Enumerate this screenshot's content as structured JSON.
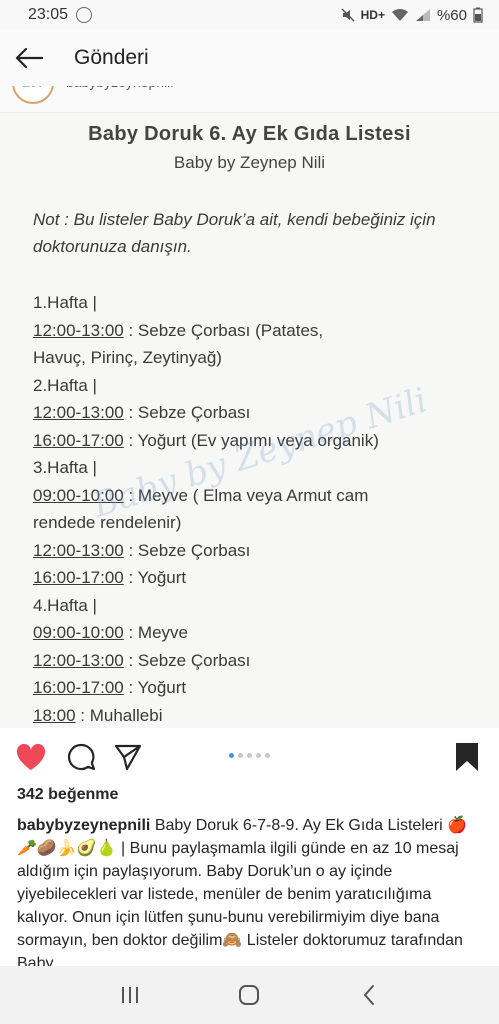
{
  "status_bar": {
    "time": "23:05",
    "network": "HD+",
    "battery": "%60"
  },
  "header": {
    "title": "Gönderi"
  },
  "post": {
    "owner": "babybyzeynepnili",
    "avatar_text": "BN",
    "image": {
      "title": "Baby Doruk 6. Ay Ek Gıda Listesi",
      "subtitle": "Baby by Zeynep Nili",
      "note": "Not : Bu listeler Baby Doruk’a ait, kendi bebeğiniz için doktorunuza danışın.",
      "watermark": "Baby by Zeynep Nili",
      "lines": [
        {
          "time": "1.Hafta |",
          "text": ""
        },
        {
          "time": "12:00-13:00",
          "text": " : Sebze Çorbası (Patates,"
        },
        {
          "time": "",
          "text": "Havuç, Pirinç, Zeytinyağ)"
        },
        {
          "time": "2.Hafta |",
          "text": ""
        },
        {
          "time": "12:00-13:00",
          "text": " : Sebze Çorbası"
        },
        {
          "time": "16:00-17:00",
          "text": " : Yoğurt (Ev yapımı veya organik)"
        },
        {
          "time": "3.Hafta |",
          "text": ""
        },
        {
          "time": "09:00-10:00",
          "text": " : Meyve ( Elma veya Armut cam"
        },
        {
          "time": "",
          "text": "rendede rendelenir)"
        },
        {
          "time": "12:00-13:00",
          "text": " : Sebze Çorbası"
        },
        {
          "time": "16:00-17:00",
          "text": " : Yoğurt"
        },
        {
          "time": "4.Hafta |",
          "text": ""
        },
        {
          "time": "09:00-10:00",
          "text": " : Meyve"
        },
        {
          "time": "12:00-13:00",
          "text": " : Sebze Çorbası"
        },
        {
          "time": "16:00-17:00",
          "text": " : Yoğurt"
        },
        {
          "time": "18:00",
          "text": " : Muhallebi"
        }
      ]
    },
    "carousel": {
      "count": 5,
      "active": 0
    },
    "likes": "342 beğenme",
    "caption_user": "babybyzeynepnili",
    "caption_text": " Baby Doruk 6-7-8-9. Ay Ek Gıda Listeleri 🍎🥕🥔🍌🥑🍐 | Bunu paylaşmamla ilgili günde en az 10 mesaj aldığım için paylaşıyorum. Baby Doruk’un o ay içinde yiyebilecekleri var listede, menüler de benim yaratıcılığıma kalıyor. Onun için lütfen şunu-bunu verebilirmiyim diye bana sormayın, ben doktor değilim🙈 Listeler doktorumuz tarafından Baby"
  },
  "icons": {
    "back": "back-arrow-icon",
    "like": "heart-icon",
    "comment": "comment-icon",
    "share": "send-icon",
    "save": "bookmark-icon"
  },
  "colors": {
    "like": "#ed4956",
    "carousel_active": "#3897f0"
  }
}
